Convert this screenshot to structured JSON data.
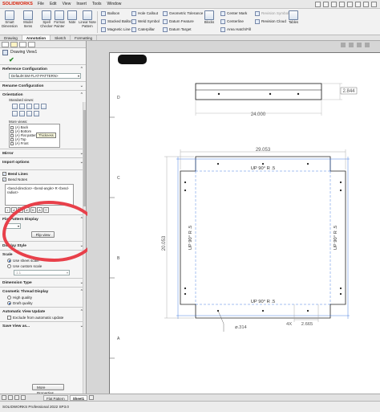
{
  "app": {
    "logo": "SOLIDWORKS",
    "menu": [
      "File",
      "Edit",
      "View",
      "Insert",
      "Tools",
      "Window"
    ]
  },
  "command_manager": {
    "big_tools": [
      "Smart Dimension",
      "Model Items",
      "Spell Checker",
      "Format Painter",
      "Note",
      "Linear Note Pattern"
    ],
    "small_tools": {
      "balloon": "Balloon",
      "auto_balloon": "Stacked Balloon",
      "magnetic_line": "Magnetic Line",
      "hole_callout": "Hole Callout",
      "weld_symbol": "Weld Symbol",
      "center_mark_small": "Caterpillar",
      "geometric_tolerance": "Geometric Tolerance",
      "datum_feature": "Datum Feature",
      "datum_target": "Datum Target",
      "surface_finish": "Blocks",
      "center_mark": "Center Mark",
      "centerline": "Centerline",
      "area_hatch": "Area Hatch/Fill",
      "revision_symbol": "Revision Symbol",
      "revision_cloud": "Revision Cloud",
      "tables": "Tables"
    }
  },
  "cmd_tabs": [
    "Drawing",
    "Annotation",
    "Sketch",
    "Formatting"
  ],
  "property_manager": {
    "title": "Drawing View1",
    "groups": {
      "reference_configuration": "Reference Configuration",
      "configuration_value": "Default<SM-FLAT-PATTERN>",
      "orientation": "Orientation",
      "standard_views_label": "Standard views:",
      "tooltip": "Thickness",
      "more_views_label": "More views:",
      "more_views": [
        "(A) Back",
        "(A) Bottom",
        "(A) Flat pattern",
        "(A) Top",
        "(A) Front"
      ],
      "mirror": "Mirror",
      "import_options": "Import options",
      "bend_lines_label": "Bend Lines",
      "bend_notes_label": "Bend Notes",
      "bend_note_text": "<bend-direction> <bend-angle> R <bend-radius>",
      "flat_pattern_display": "Flat Pattern Display",
      "flip_view": "Flip view",
      "display_style": "Display Style",
      "scale": "Scale",
      "use_sheet_scale": "Use sheet scale",
      "use_custom_scale": "Use custom scale",
      "scale_value": "1:1",
      "dimension_type": "Dimension Type",
      "cosmetic_thread_display": "Cosmetic Thread Display",
      "high_quality": "High quality",
      "draft_quality": "Draft quality",
      "automatic_view_update": "Automatic View Update",
      "exclude_auto_update": "Exclude from automatic update",
      "save_view_as": "Save View as...",
      "more_properties": "More Properties..."
    }
  },
  "drawing": {
    "row_labels": [
      "D",
      "C",
      "B",
      "A"
    ],
    "top_view": {
      "width_dim": "24.000",
      "thickness_dim": "2.844"
    },
    "flat_view": {
      "top_dim": "29.053",
      "side_dim": "20.053",
      "bend_notes": [
        "UP 90° R .5",
        "UP 90° R .5",
        "UP 90° R .5",
        "UP 90° R .5"
      ],
      "hole_callout_count": "4X",
      "hole_spacing_dim": "2.665",
      "hole_dia": "⌀.314"
    }
  },
  "sheet_tabs": [
    "Flat Pattern",
    "Sheet1"
  ],
  "status": {
    "text": "SOLIDWORKS Professional 2022 SP3.0"
  }
}
